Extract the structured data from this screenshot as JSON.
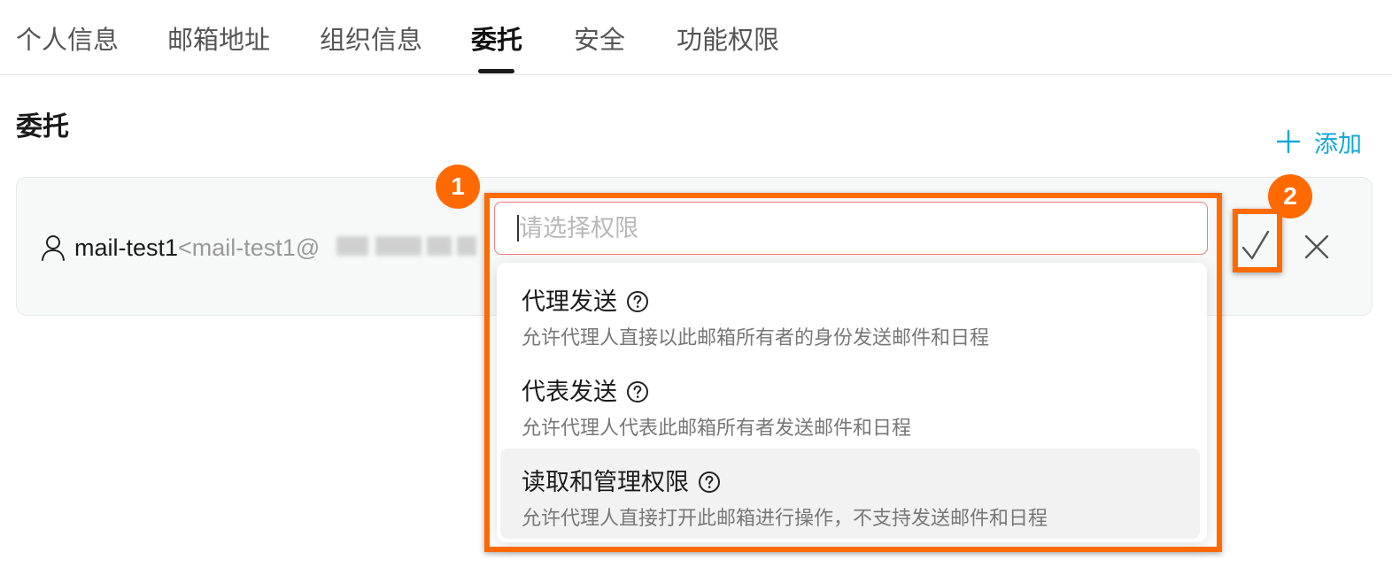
{
  "tabs": [
    {
      "label": "个人信息"
    },
    {
      "label": "邮箱地址"
    },
    {
      "label": "组织信息"
    },
    {
      "label": "委托",
      "active": true
    },
    {
      "label": "安全"
    },
    {
      "label": "功能权限"
    }
  ],
  "section": {
    "title": "委托"
  },
  "add_button": {
    "label": "添加"
  },
  "delegate": {
    "name": "mail-test1",
    "email_prefix": "<mail-test1@"
  },
  "permission_select": {
    "placeholder": "请选择权限",
    "options": [
      {
        "title": "代理发送",
        "description": "允许代理人直接以此邮箱所有者的身份发送邮件和日程"
      },
      {
        "title": "代表发送",
        "description": "允许代理人代表此邮箱所有者发送邮件和日程"
      },
      {
        "title": "读取和管理权限",
        "description": "允许代理人直接打开此邮箱进行操作，不支持发送邮件和日程",
        "highlighted": true
      }
    ]
  },
  "annotations": [
    {
      "label": "1"
    },
    {
      "label": "2"
    }
  ],
  "colors": {
    "accent": "#12a8d6",
    "annotation": "#ff6a00",
    "error_border": "#f07a7a"
  }
}
